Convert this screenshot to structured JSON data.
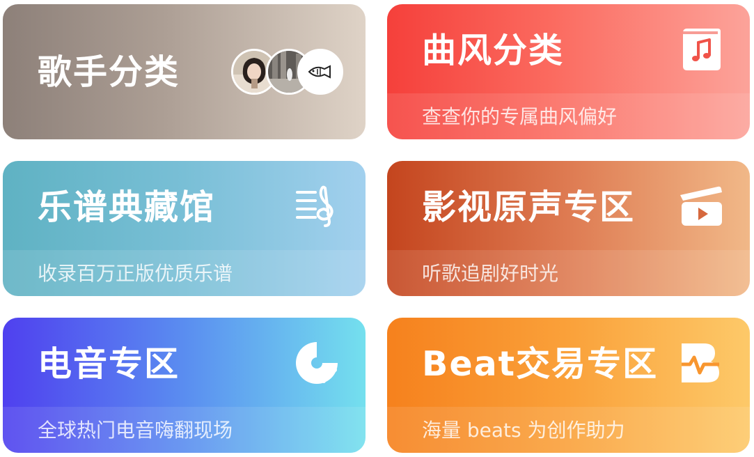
{
  "cards": [
    {
      "title": "歌手分类",
      "subtitle": "",
      "icon": "singer-avatars"
    },
    {
      "title": "曲风分类",
      "subtitle": "查查你的专属曲风偏好",
      "icon": "music-book-icon"
    },
    {
      "title": "乐谱典藏馆",
      "subtitle": "收录百万正版优质乐谱",
      "icon": "treble-clef-sheet-icon"
    },
    {
      "title": "影视原声专区",
      "subtitle": "听歌追剧好时光",
      "icon": "clapperboard-icon"
    },
    {
      "title": "电音专区",
      "subtitle": "全球热门电音嗨翻现场",
      "icon": "vinyl-dots-icon"
    },
    {
      "title": "Beat交易专区",
      "subtitle": "海量 beats 为创作助力",
      "icon": "beat-b-icon"
    }
  ],
  "colors": {
    "singer": [
      "#8d8079",
      "#dfd3c7"
    ],
    "genre": [
      "#f5403b",
      "#fca39a"
    ],
    "sheet": [
      "#5fb2c3",
      "#a2d0ee"
    ],
    "film": [
      "#c4451e",
      "#f1b888"
    ],
    "edm": [
      "#4f40ef",
      "#74e0ee"
    ],
    "beat": [
      "#f6811d",
      "#fdc969"
    ]
  }
}
